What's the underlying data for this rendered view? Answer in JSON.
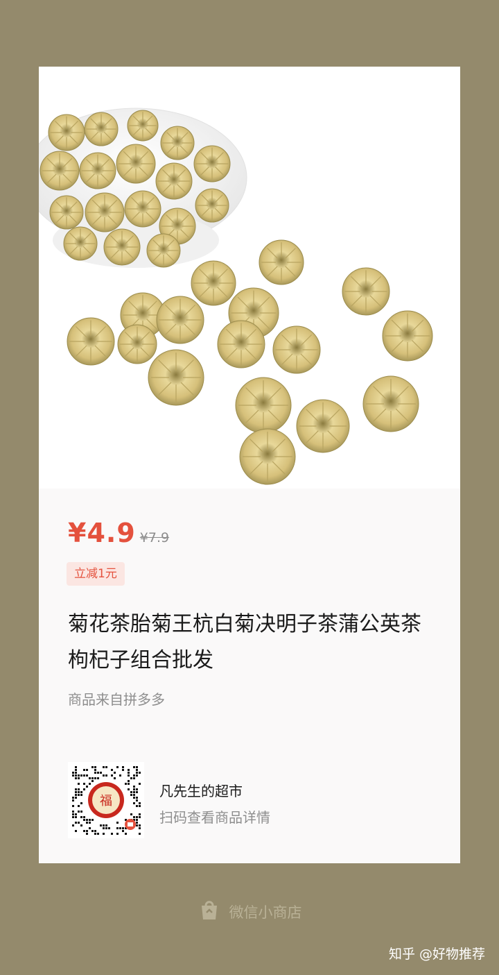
{
  "product": {
    "price_current": "¥4.9",
    "price_original": "¥7.9",
    "discount_badge": "立减1元",
    "title": "菊花茶胎菊王杭白菊决明子茶蒲公英茶枸杞子组合批发",
    "source": "商品来自拼多多",
    "image_icon": "chrysanthemum-tea-photo"
  },
  "shop": {
    "name": "凡先生的超市",
    "scan_hint": "扫码查看商品详情",
    "qr_center_char": "福",
    "qr_icon": "qr-code-icon"
  },
  "footer": {
    "brand": "微信小商店",
    "brand_icon": "shopping-bag-icon"
  },
  "watermark": "知乎 @好物推荐",
  "colors": {
    "background": "#948a6c",
    "price_red": "#e4513d",
    "badge_bg": "#fbe6e2"
  }
}
